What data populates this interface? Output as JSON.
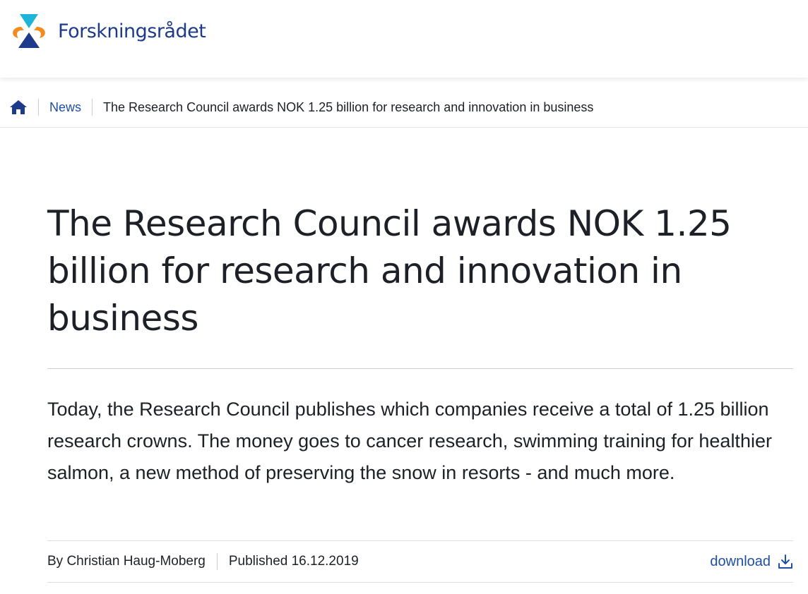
{
  "header": {
    "logo_text": "Forskningsrådet",
    "colors": {
      "brand_blue": "#1e3a8a",
      "logo_orange": "#f28c1e",
      "logo_cyan": "#1cb5d8"
    }
  },
  "breadcrumb": {
    "home_icon": "home-icon",
    "news": "News",
    "current": "The Research Council awards NOK 1.25 billion for research and innovation in business"
  },
  "article": {
    "title": "The Research Council awards NOK 1.25 billion for research and innovation in business",
    "lede": "Today, the Research Council publishes which companies receive a total of 1.25 billion research crowns. The money goes to cancer research, swimming training for healthier salmon, a new method of preserving the snow in resorts - and much more.",
    "author": "By Christian Haug-Moberg",
    "published": "Published 16.12.2019",
    "download_label": "download",
    "download_icon": "download-icon"
  },
  "colors": {
    "link": "#1e4fa3",
    "text": "#1d2026",
    "divider": "#c9ccd2"
  }
}
